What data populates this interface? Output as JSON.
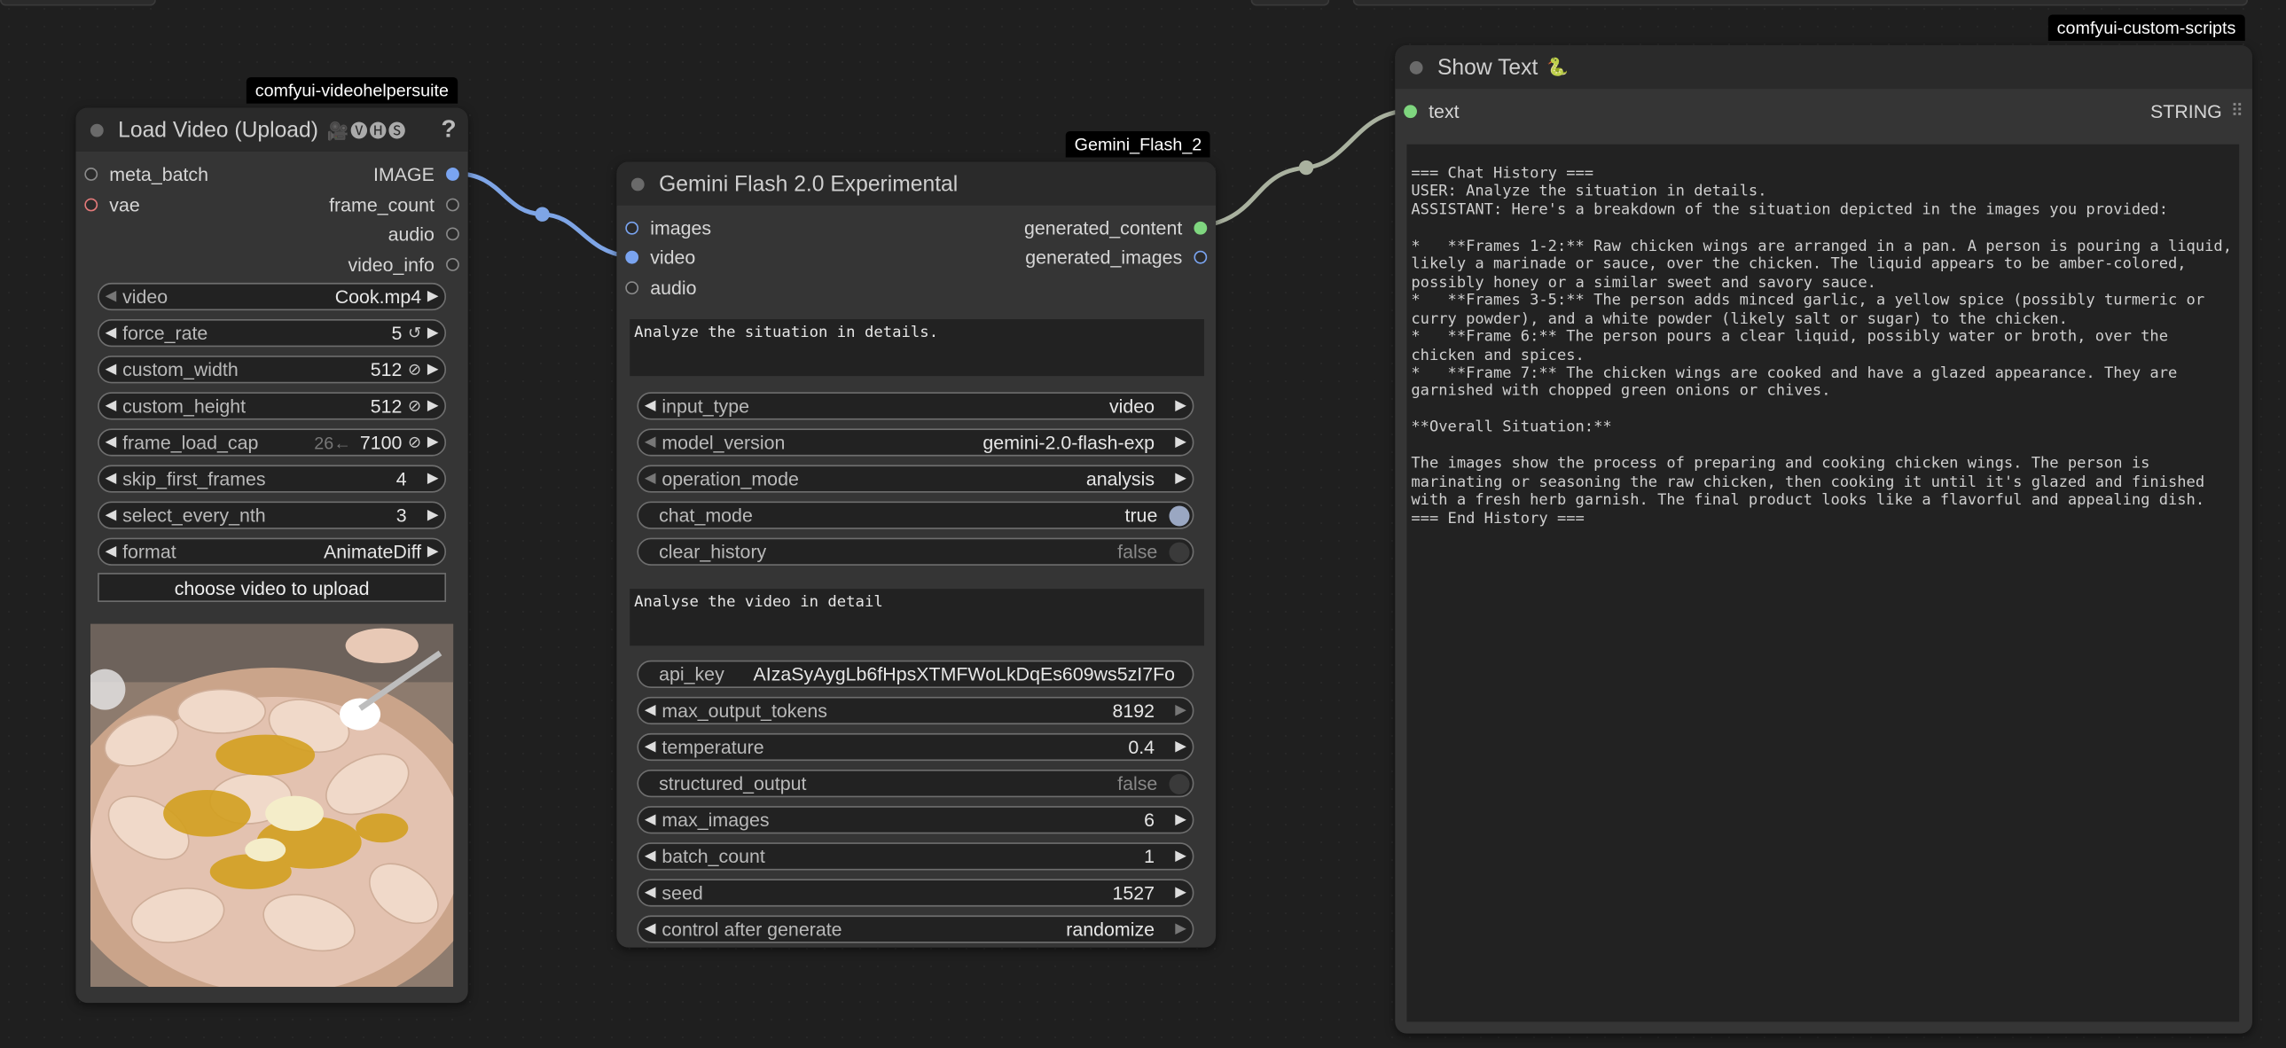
{
  "colors": {
    "canvas_bg": "#1f1f1f",
    "node_bg": "#353535",
    "title_bg": "#2a2a2a",
    "widget_bg": "#222222",
    "link_blue": "#7ea5e6",
    "link_gray": "#a9b19f",
    "dot_green": "#7fd67f",
    "dot_red": "#e37a7a",
    "dot_blue": "#7aa4f0"
  },
  "load_video": {
    "badge": "comfyui-videohelpersuite",
    "title": "Load Video (Upload)",
    "title_extra": "🎥🅥🅗🅢",
    "help": "?",
    "inputs": [
      "meta_batch",
      "vae"
    ],
    "outputs": [
      "IMAGE",
      "frame_count",
      "audio",
      "video_info"
    ],
    "widgets": [
      {
        "label": "video",
        "value": "Cook.mp4"
      },
      {
        "label": "force_rate",
        "value": "5",
        "icon": "↺"
      },
      {
        "label": "custom_width",
        "value": "512",
        "icon": "⊘"
      },
      {
        "label": "custom_height",
        "value": "512",
        "icon": "⊘"
      },
      {
        "label": "frame_load_cap",
        "extra": "26←",
        "value": "7100",
        "icon": "⊘"
      },
      {
        "label": "skip_first_frames",
        "value": "4"
      },
      {
        "label": "select_every_nth",
        "value": "3"
      },
      {
        "label": "format",
        "value": "AnimateDiff"
      }
    ],
    "upload_button": "choose video to upload",
    "preview_alt": "raw chicken wings with spices in a pan"
  },
  "gemini": {
    "badge": "Gemini_Flash_2",
    "title": "Gemini Flash 2.0 Experimental",
    "inputs": [
      "images",
      "video",
      "audio"
    ],
    "outputs": [
      "generated_content",
      "generated_images"
    ],
    "prompt": "Analyze the situation in details.",
    "widgets1": [
      {
        "label": "input_type",
        "value": "video"
      },
      {
        "label": "model_version",
        "value": "gemini-2.0-flash-exp"
      },
      {
        "label": "operation_mode",
        "value": "analysis"
      }
    ],
    "chat_mode": {
      "label": "chat_mode",
      "value": "true"
    },
    "clear_history": {
      "label": "clear_history",
      "value": "false"
    },
    "prompt2": "Analyse the video in detail",
    "api_key": {
      "label": "api_key",
      "value": "AIzaSyAygLb6fHpsXTMFWoLkDqEs609ws5zI7Fo"
    },
    "max_output_tokens": {
      "label": "max_output_tokens",
      "value": "8192"
    },
    "temperature": {
      "label": "temperature",
      "value": "0.4"
    },
    "structured_output": {
      "label": "structured_output",
      "value": "false"
    },
    "widgets2": [
      {
        "label": "max_images",
        "value": "6"
      },
      {
        "label": "batch_count",
        "value": "1"
      },
      {
        "label": "seed",
        "value": "1527"
      },
      {
        "label": "control after generate",
        "value": "randomize"
      }
    ]
  },
  "show_text": {
    "badge": "comfyui-custom-scripts",
    "title": "Show Text",
    "title_extra": "🐍",
    "input": "text",
    "output": "STRING",
    "output_icon": "⠿",
    "content": "=== Chat History ===\nUSER: Analyze the situation in details.\nASSISTANT: Here's a breakdown of the situation depicted in the images you provided:\n\n*   **Frames 1-2:** Raw chicken wings are arranged in a pan. A person is pouring a liquid,\nlikely a marinade or sauce, over the chicken. The liquid appears to be amber-colored,\npossibly honey or a similar sweet and savory sauce.\n*   **Frames 3-5:** The person adds minced garlic, a yellow spice (possibly turmeric or\ncurry powder), and a white powder (likely salt or sugar) to the chicken.\n*   **Frame 6:** The person pours a clear liquid, possibly water or broth, over the\nchicken and spices.\n*   **Frame 7:** The chicken wings are cooked and have a glazed appearance. They are\ngarnished with chopped green onions or chives.\n\n**Overall Situation:**\n\nThe images show the process of preparing and cooking chicken wings. The person is\nmarinating or seasoning the raw chicken, then cooking it until it's glazed and finished\nwith a fresh herb garnish. The final product looks like a flavorful and appealing dish.\n=== End History ==="
  }
}
